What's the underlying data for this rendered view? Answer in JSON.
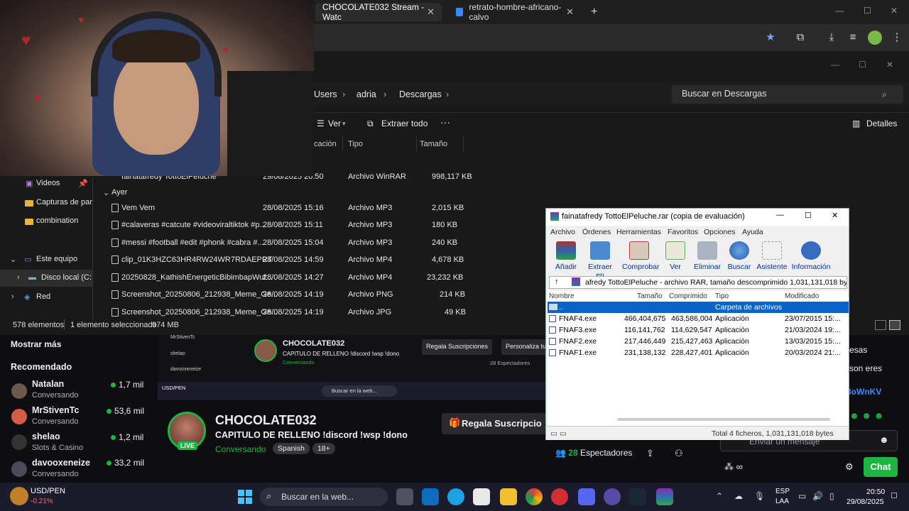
{
  "browser": {
    "tabs": [
      {
        "title": "CHOCOLATE032 Stream - Watc"
      },
      {
        "title": "retrato-hombre-africano-calvo"
      }
    ],
    "new_tab": "+"
  },
  "explorer": {
    "breadcrumbs": [
      "Users",
      "adria",
      "Descargas"
    ],
    "search_placeholder": "Buscar en Descargas",
    "commands": {
      "view": "Ver",
      "extract_all": "Extraer todo",
      "more": "···",
      "details": "Detalles"
    },
    "columns": {
      "location": "cación",
      "type": "Tipo",
      "size": "Tamaño"
    },
    "partial_row": {
      "name": "fainatafredy TottoElPeluche",
      "date": "29/08/2025 20:50",
      "type": "Archivo WinRAR",
      "size": "998,117 KB"
    },
    "group_label": "Ayer",
    "files": [
      {
        "name": "Vem Vem",
        "date": "28/08/2025 15:16",
        "type": "Archivo MP3",
        "size": "2,015 KB"
      },
      {
        "name": "#calaveras #catcute #videoviraltiktok #p...",
        "date": "28/08/2025 15:11",
        "type": "Archivo MP3",
        "size": "180 KB"
      },
      {
        "name": "#messi #football #edit #phonk #cabra #...",
        "date": "28/08/2025 15:04",
        "type": "Archivo MP3",
        "size": "240 KB"
      },
      {
        "name": "clip_01K3HZC63HR4RW24WR7RDAEPRT",
        "date": "28/08/2025 14:59",
        "type": "Archivo MP4",
        "size": "4,678 KB"
      },
      {
        "name": "20250828_KathishEnergeticBibimbapWut...",
        "date": "28/08/2025 14:27",
        "type": "Archivo MP4",
        "size": "23,232 KB"
      },
      {
        "name": "Screenshot_20250806_212938_Meme_Ge...",
        "date": "28/08/2025 14:19",
        "type": "Archivo PNG",
        "size": "214 KB"
      },
      {
        "name": "Screenshot_20250806_212938_Meme_Ge...",
        "date": "28/08/2025 14:19",
        "type": "Archivo JPG",
        "size": "49 KB"
      }
    ],
    "nav": [
      {
        "label": "Videos"
      },
      {
        "label": "Capturas de par"
      },
      {
        "label": "combination"
      },
      {
        "label": "Este equipo"
      },
      {
        "label": "Disco local (C:"
      },
      {
        "label": "Red"
      }
    ],
    "status": {
      "count": "578 elementos",
      "selected": "1 elemento seleccionado",
      "size": "974 MB"
    }
  },
  "twitch": {
    "show_more": "Mostrar más",
    "recommended_title": "Recomendado",
    "recommended": [
      {
        "name": "Natalan",
        "sub": "Conversando",
        "viewers": "1,7 mil"
      },
      {
        "name": "MrStivenTc",
        "sub": "Conversando",
        "viewers": "53,6 mil"
      },
      {
        "name": "shelao",
        "sub": "Slots & Casino",
        "viewers": "1,2 mil"
      },
      {
        "name": "davooxeneize",
        "sub": "Conversando",
        "viewers": "33,2 mil"
      }
    ],
    "ticker": {
      "label": "USD/PEN",
      "change": "-0.21%"
    },
    "channel": {
      "name": "CHOCOLATE032",
      "title": "CAPITULO DE RELLENO !discord !wsp !dono",
      "category": "Conversando",
      "tags": [
        "Spanish",
        "18+"
      ],
      "live": "LIVE",
      "viewers": "28",
      "viewers_label": "Espectadores"
    },
    "gift_button": "Regala Suscripcio",
    "mini": {
      "gift": "Regala Suscripciones",
      "personalize": "Personaliza tu",
      "viewers": "28 Espectadores",
      "search": "Buscar en la web..."
    },
    "chat_fragments": [
      "esas",
      "son eres",
      "3oWnKV"
    ],
    "chat_placeholder": "Enviar un mensaje",
    "chat_button": "Chat"
  },
  "winrar": {
    "title": "fainatafredy TottoElPeluche.rar (copia de evaluación)",
    "menu": [
      "Archivo",
      "Órdenes",
      "Herramientas",
      "Favoritos",
      "Opciones",
      "Ayuda"
    ],
    "toolbar": [
      "Añadir",
      "Extraer en",
      "Comprobar",
      "Ver",
      "Eliminar",
      "Buscar",
      "Asistente",
      "Información"
    ],
    "path": "afredy TottoElPeluche - archivo RAR, tamaño descomprimido 1,031,131,018 bytes",
    "columns": [
      "Nombre",
      "Tamaño",
      "Comprimido",
      "Tipo",
      "Modificado"
    ],
    "parent_row": {
      "name": "..",
      "type": "Carpeta de archivos"
    },
    "files": [
      {
        "name": "FNAF4.exe",
        "size": "466,404,675",
        "packed": "463,586,004",
        "type": "Aplicación",
        "modified": "23/07/2015 15:..."
      },
      {
        "name": "FNAF3.exe",
        "size": "116,141,762",
        "packed": "114,629,547",
        "type": "Aplicación",
        "modified": "21/03/2024 19:..."
      },
      {
        "name": "FNAF2.exe",
        "size": "217,446,449",
        "packed": "215,427,463",
        "type": "Aplicación",
        "modified": "13/03/2015 15:..."
      },
      {
        "name": "FNAF1.exe",
        "size": "231,138,132",
        "packed": "228,427,401",
        "type": "Aplicación",
        "modified": "20/03/2024 21:..."
      }
    ],
    "status": "Total 4 ficheros, 1,031,131,018 bytes"
  },
  "taskbar": {
    "search": "Buscar en la web...",
    "ticker": {
      "label": "USD/PEN",
      "change": "-0.21%"
    },
    "lang": "ESP",
    "lang2": "LAA",
    "time": "20:50",
    "date": "29/08/2025"
  }
}
